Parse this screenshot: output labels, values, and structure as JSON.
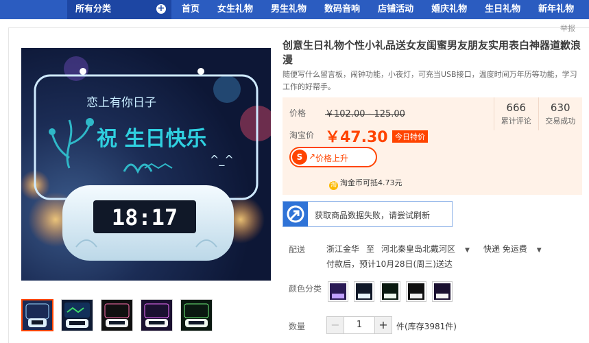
{
  "nav": {
    "all_categories": "所有分类",
    "links": [
      "首页",
      "女生礼物",
      "男生礼物",
      "数码音响",
      "店铺活动",
      "婚庆礼物",
      "生日礼物",
      "新年礼物"
    ]
  },
  "report_label": "举报",
  "product": {
    "title": "创意生日礼物个性小礼品送女友闺蜜男友朋友实用表白神器道歉浪漫",
    "subtitle": "随便写什么留言板，闹钟功能，小夜灯，可充当USB接口，温度时间万年历等功能，学习工作的好帮手。",
    "image_text_top": "恋上有你日子",
    "image_text_main": "祝 生日快乐",
    "clock_display": "18:17"
  },
  "price": {
    "orig_label": "价格",
    "orig_value": "￥102.00 - 125.00",
    "sale_label": "淘宝价",
    "sale_value": "￥47.30",
    "today_tag": "今日特价",
    "rise_button": "价格上升",
    "coin_text": "淘金币可抵4.73元"
  },
  "stats": [
    {
      "num": "666",
      "label": "累计评论"
    },
    {
      "num": "630",
      "label": "交易成功"
    }
  ],
  "fail_message": "获取商品数据失败，请尝试刷新",
  "shipping": {
    "label": "配送",
    "from": "浙江金华",
    "to_word": "至",
    "to": "河北秦皇岛北戴河区",
    "method": "快递 免运费",
    "note": "付款后，预计10月28日(周三)送达"
  },
  "color_label": "颜色分类",
  "quantity": {
    "label": "数量",
    "minus": "−",
    "value": "1",
    "plus": "+",
    "stock": "件(库存3981件)"
  },
  "colors": {
    "nav_bg": "#2b5cc0",
    "accent": "#ff4400",
    "price_bg": "#fff2e8"
  }
}
